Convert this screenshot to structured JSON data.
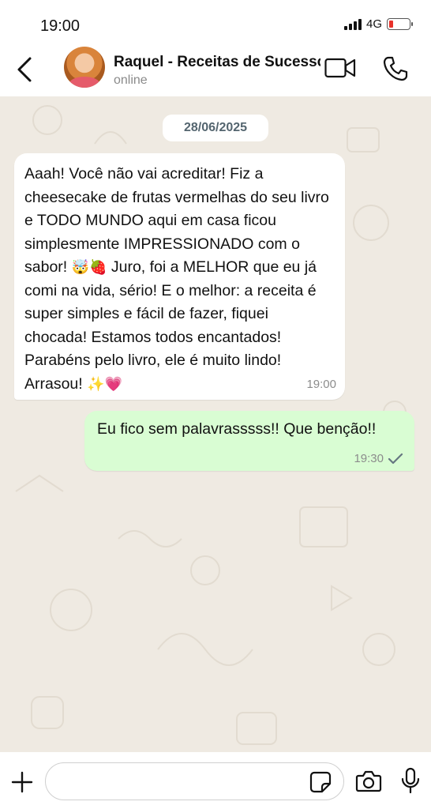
{
  "status_bar": {
    "time": "19:00",
    "network": "4G"
  },
  "header": {
    "contact_name": "Raquel - Receitas de Sucesso",
    "contact_status": "online",
    "icons": {
      "back": "back-arrow-icon",
      "video": "video-camera-icon",
      "call": "phone-icon"
    }
  },
  "chat": {
    "date": "28/06/2025",
    "messages": [
      {
        "direction": "incoming",
        "parts": [
          "Aaah! Você não vai acreditar! Fiz a cheesecake de frutas vermelhas do seu livro e TODO MUNDO aqui em casa ficou simplesmente IMPRESSIONADO com o sabor! ",
          "🤯🍓",
          " Juro, foi a MELHOR que eu já comi na vida, sério! E o melhor: a receita é super simples e fácil de fazer, fiquei chocada! Estamos todos encantados! Parabéns pelo livro, ele é muito lindo! Arrasou! ",
          "✨💗"
        ],
        "time": "19:00"
      },
      {
        "direction": "outgoing",
        "text": "Eu fico sem palavrasssss!! Que benção!!",
        "time": "19:30",
        "status_icon": "single-check-icon"
      }
    ]
  },
  "input_bar": {
    "placeholder": "",
    "icons": {
      "attach": "plus-icon",
      "sticker": "sticker-icon",
      "camera": "camera-icon",
      "mic": "microphone-icon"
    }
  },
  "colors": {
    "outgoing_bubble": "#d9fdd3",
    "incoming_bubble": "#ffffff",
    "chat_background": "#efeae2",
    "battery_low": "#e8322a"
  }
}
